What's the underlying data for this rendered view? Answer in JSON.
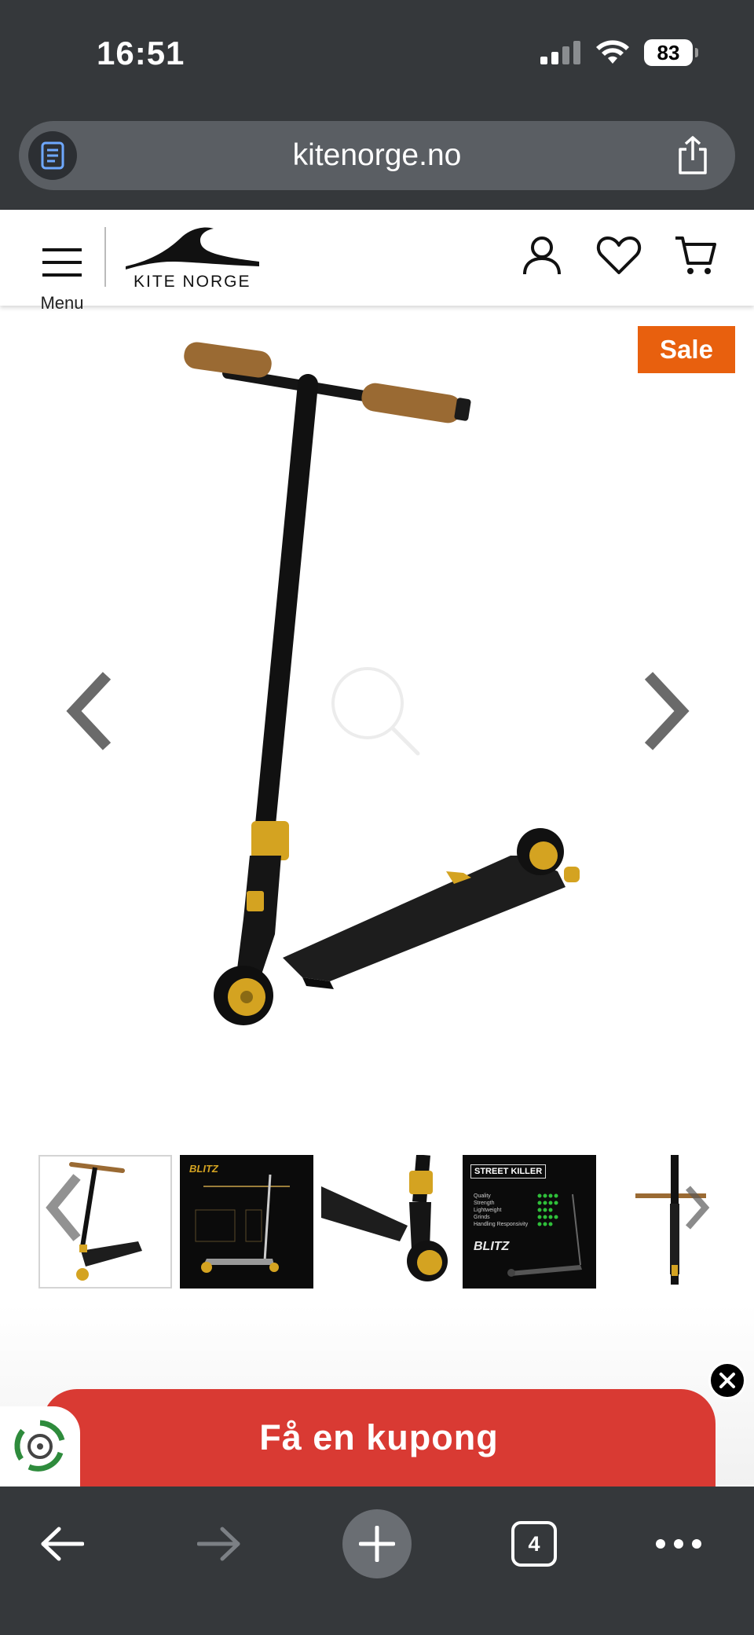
{
  "status_bar": {
    "time": "16:51",
    "battery": "83",
    "icons": [
      "cellular-signal-icon",
      "wifi-icon",
      "battery-icon"
    ]
  },
  "browser": {
    "url": "kitenorge.no",
    "icons": [
      "reader-mode-icon",
      "share-icon"
    ]
  },
  "site_header": {
    "menu_label": "Menu",
    "logo_text": "KITE NORGE",
    "icons": [
      "hamburger-icon",
      "user-account-icon",
      "wishlist-heart-icon",
      "shopping-cart-icon"
    ]
  },
  "product_gallery": {
    "badge": "Sale",
    "thumbnail_count": 5,
    "thumbnail_label_text": "BLITZ",
    "thumbnail_specs_title": "STREET KILLER",
    "thumbnail_specs": [
      "Quality",
      "Strength",
      "Lightweight",
      "Grinds",
      "Handling Responsivity"
    ],
    "colors": {
      "sale_badge": "#e8600e",
      "scooter_accent": "#d4a321",
      "grip_brown": "#9a6a33"
    }
  },
  "coupon_banner": {
    "label": "Få en kupong",
    "color": "#d93a33"
  },
  "browser_toolbar": {
    "tab_count": "4",
    "icons": [
      "back-arrow-icon",
      "forward-arrow-icon",
      "new-tab-plus-icon",
      "tabs-icon",
      "more-icon"
    ]
  }
}
